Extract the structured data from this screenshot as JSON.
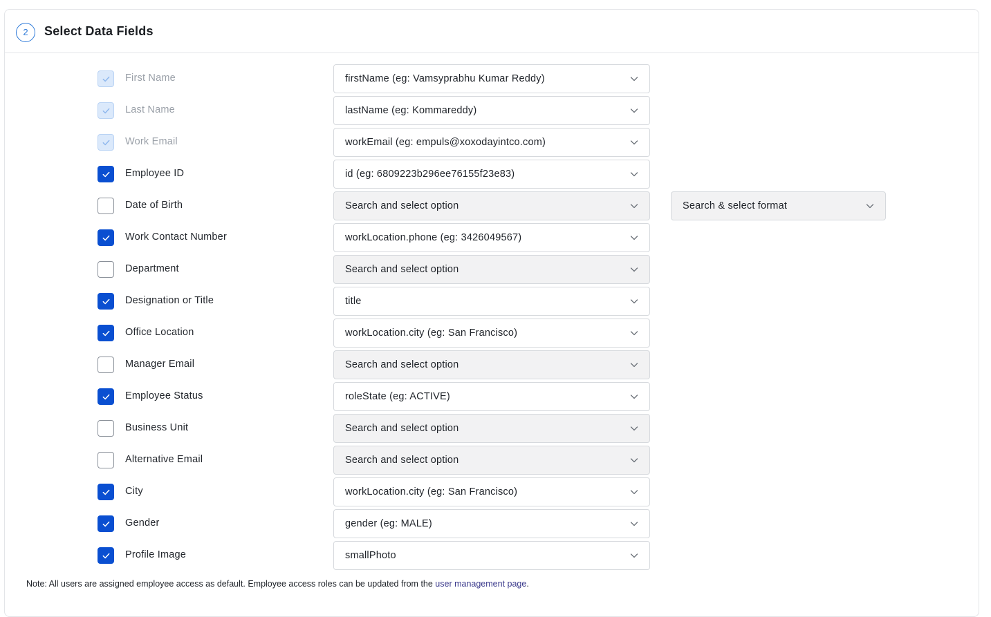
{
  "section": {
    "step_number": "2",
    "title": "Select Data Fields"
  },
  "fields": [
    {
      "label": "First Name",
      "state": "disabled",
      "value": "firstName (eg: Vamsyprabhu Kumar Reddy)"
    },
    {
      "label": "Last Name",
      "state": "disabled",
      "value": "lastName (eg: Kommareddy)"
    },
    {
      "label": "Work Email",
      "state": "disabled",
      "value": "workEmail (eg: empuls@xoxodayintco.com)"
    },
    {
      "label": "Employee ID",
      "state": "checked",
      "value": "id (eg: 6809223b296ee76155f23e83)"
    },
    {
      "label": "Date of Birth",
      "state": "unchecked",
      "value": "Search and select option"
    },
    {
      "label": "Work Contact Number",
      "state": "checked",
      "value": "workLocation.phone (eg: 3426049567)"
    },
    {
      "label": "Department",
      "state": "unchecked",
      "value": "Search and select option"
    },
    {
      "label": "Designation or Title",
      "state": "checked",
      "value": "title"
    },
    {
      "label": "Office Location",
      "state": "checked",
      "value": "workLocation.city (eg: San Francisco)"
    },
    {
      "label": "Manager Email",
      "state": "unchecked",
      "value": "Search and select option"
    },
    {
      "label": "Employee Status",
      "state": "checked",
      "value": "roleState (eg: ACTIVE)"
    },
    {
      "label": "Business Unit",
      "state": "unchecked",
      "value": "Search and select option"
    },
    {
      "label": "Alternative Email",
      "state": "unchecked",
      "value": "Search and select option"
    },
    {
      "label": "City",
      "state": "checked",
      "value": "workLocation.city (eg: San Francisco)"
    },
    {
      "label": "Gender",
      "state": "checked",
      "value": "gender (eg: MALE)"
    },
    {
      "label": "Profile Image",
      "state": "checked",
      "value": "smallPhoto"
    }
  ],
  "date_format_select": {
    "value": "Search & select format"
  },
  "note": {
    "text": "Note: All users are assigned employee access as default. Employee access roles can be updated from the ",
    "link": "user management page",
    "suffix": "."
  },
  "colors": {
    "accent": "#0a4fd1",
    "step_circle": "#2f7bd9",
    "link": "#3b3a8c"
  }
}
